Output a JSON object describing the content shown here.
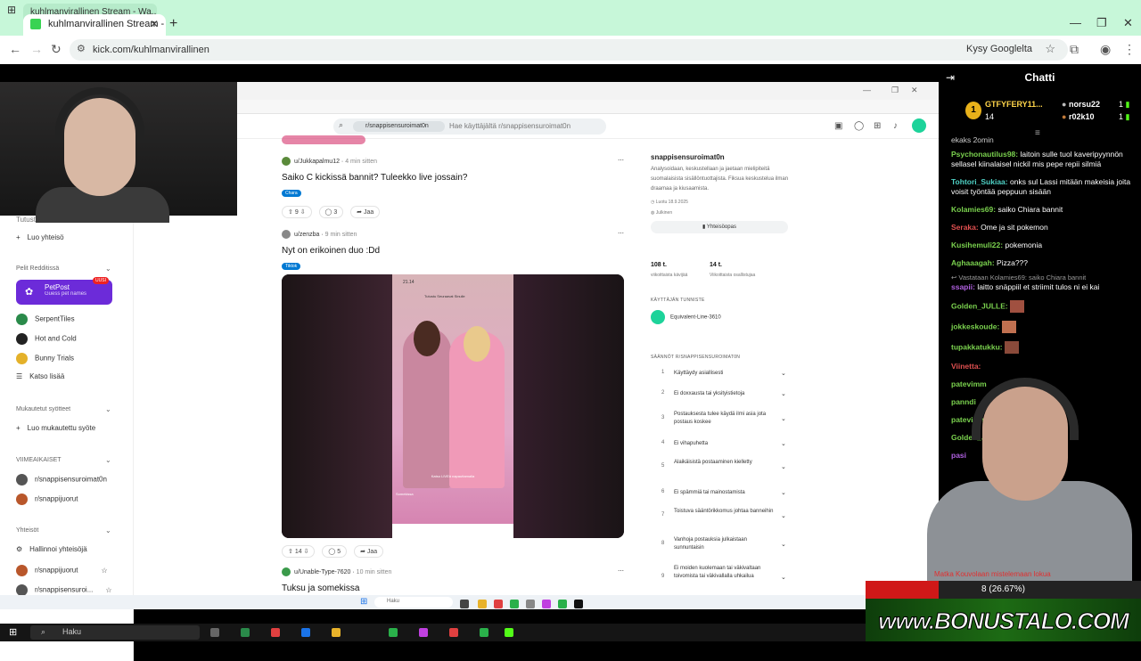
{
  "browser": {
    "prev_tab": "kuhlmanvirallinen Stream - Wa...",
    "tab_title": "kuhlmanvirallinen Stream - Wat",
    "url": "kick.com/kuhlmanvirallinen",
    "ask_google": "Kysy Googlelta"
  },
  "reddit": {
    "search_chip": "r/snappisensuroimat0n",
    "search_placeholder": "Hae käyttäjältä r/snappisensuroimat0n",
    "sidebar": {
      "item_top": "Tutustu",
      "create_community": "Luo yhteisö",
      "games_header": "Pelit Redditissä",
      "petpost": "PetPost",
      "petpost_sub": "Guess pet names",
      "petpost_badge": "UUSI",
      "games": [
        "SerpentTiles",
        "Hot and Cold",
        "Bunny Trials"
      ],
      "see_all": "Katso lisää",
      "custom_feeds_header": "Mukautetut syötteet",
      "create_custom_feed": "Luo mukautettu syöte",
      "recent_header": "VIIMEAIKAISET",
      "recent": [
        "r/snappisensuroimat0n",
        "r/snappijuorut"
      ],
      "communities_header": "Yhteisöt",
      "manage_communities": "Hallinnoi yhteisöjä",
      "communities": [
        "r/snappijuorut",
        "r/snappisensuroi..."
      ]
    },
    "posts": [
      {
        "user": "u/Jukkapalmu12",
        "time": "4 min sitten",
        "title": "Saiko C kickissä bannit? Tuleekko live jossain?",
        "flair": "Chara",
        "votes": "9",
        "comments": "3",
        "share": "Jaa"
      },
      {
        "user": "u/zenzba",
        "time": "9 min sitten",
        "title": "Nyt on erikoinen duo :Dd",
        "flair": "Tiktok",
        "votes": "14",
        "comments": "5",
        "share": "Jaa",
        "phone_time": "21.14",
        "phone_tabs": "Tutustu  Seuraavat  Sinulle",
        "phone_live": "Katso LIVEä napauttamalla",
        "phone_info": "Somekissa"
      },
      {
        "user": "u/Unable-Type-7620",
        "time": "10 min sitten",
        "title": "Tuksu ja somekissa"
      }
    ],
    "about": {
      "name": "snappisensuroimat0n",
      "description": "Analysoidaan, keskustellaan ja jaetaan mielipiteitä suomalaisista sisällöntuottajista. Fiksua keskustelua ilman draamaa ja kiusaamista.",
      "created": "Luotu 18.9.2025",
      "public": "Julkinen",
      "guide_button": "Yhteisöopas",
      "members": "108 t.",
      "members_label": "viikoittaista kävijää",
      "contributions": "14 t.",
      "contributions_label": "Viikoittaista osallistujaa",
      "flair_header": "KÄYTTÄJÄN TUNNISTE",
      "flair_user": "Equivalent-Line-3610",
      "rules_header": "SÄÄNNÖT R/SNAPPISENSUROIMAT0N",
      "rules": [
        {
          "n": "1",
          "t": "Käyttäydy asiallisesti"
        },
        {
          "n": "2",
          "t": "Ei doxxausta tai yksityistietoja"
        },
        {
          "n": "3",
          "t": "Postauksesta tulee käydä ilmi asia jota postaus koskee"
        },
        {
          "n": "4",
          "t": "Ei vihapuhetta"
        },
        {
          "n": "5",
          "t": "Alaikäisistä postaaminen kielletty"
        },
        {
          "n": "6",
          "t": "Ei spämmiä tai mainostamista"
        },
        {
          "n": "7",
          "t": "Toistuva sääntörikkomus johtaa banneihin"
        },
        {
          "n": "8",
          "t": "Vanhoja postauksia julkaistaan sunnuntaisin"
        },
        {
          "n": "9",
          "t": "Ei moiden kuolemaan tai väkivaltaan toivomista tai väkivallalla uhkailua"
        }
      ]
    }
  },
  "chat": {
    "title": "Chatti",
    "top_gifter_1": "GTFYFERY11...",
    "top_gifter_1_count": "14",
    "gifter_2": "norsu22",
    "gifter_2_count": "1",
    "gifter_3": "r02k10",
    "gifter_3_count": "1",
    "rank_badge": "1",
    "messages": [
      {
        "user": "",
        "text": "ekaks 2omin",
        "color": "#ffffff"
      },
      {
        "user": "Psychonautilus98:",
        "text": "laitoin sulle tuol kaveripyynnön sellasel kiinalaisel nickil mis pepe repii silmiä",
        "color": "#7ad14e"
      },
      {
        "user": "Tohtori_Sukiaa:",
        "text": "onks sul Lassi mitään makeisia joita voisit työntää peppuun sisään",
        "color": "#4fd1c5"
      },
      {
        "user": "Kolamies69:",
        "text": "saiko Chiara bannit",
        "color": "#7ad14e"
      },
      {
        "user": "Seraka:",
        "text": "Ome ja sit pokemon",
        "color": "#e05050"
      },
      {
        "user": "Kusihemuli22:",
        "text": "pokemonia",
        "color": "#7ad14e"
      },
      {
        "user": "Aghaaagah:",
        "text": "Pizza???",
        "color": "#7ad14e"
      },
      {
        "user": "ssapii:",
        "text": "laitto snäppiil et striimit tulos ni ei kai",
        "color": "#b060e0"
      },
      {
        "user": "Golden_JULLE:",
        "text": "",
        "color": "#7ad14e"
      },
      {
        "user": "jokkeskoude:",
        "text": "",
        "color": "#7ad14e"
      },
      {
        "user": "tupakkatukku:",
        "text": "",
        "color": "#7ad14e"
      },
      {
        "user": "Viinetta:",
        "text": "",
        "color": "#e05050"
      },
      {
        "user": "patevimm",
        "text": "",
        "color": "#7ad14e"
      },
      {
        "user": "panndi",
        "text": "",
        "color": "#7ad14e"
      },
      {
        "user": "patevimm",
        "text": "",
        "color": "#7ad14e"
      },
      {
        "user": "Golden_J",
        "text": "",
        "color": "#7ad14e"
      },
      {
        "user": "pasi",
        "text": "",
        "color": "#b060e0"
      }
    ],
    "reply_to": "Vastataan Kolamies69: saiko Chiara bannit"
  },
  "overlay": {
    "goal_message": "Matka Kouvolaan mistelemaan lokua",
    "goal_text": "8 (26.67%)",
    "goal_fraction": 0.2667,
    "sponsor": "www.BONUSTALO.COM"
  },
  "taskbar": {
    "search": "Haku",
    "inner_search": "Haku"
  },
  "colors": {
    "accent_green": "#53fc18",
    "reddit_purple": "#6c2bd9",
    "chat_bg": "#000000",
    "goal_red": "#d01818"
  }
}
